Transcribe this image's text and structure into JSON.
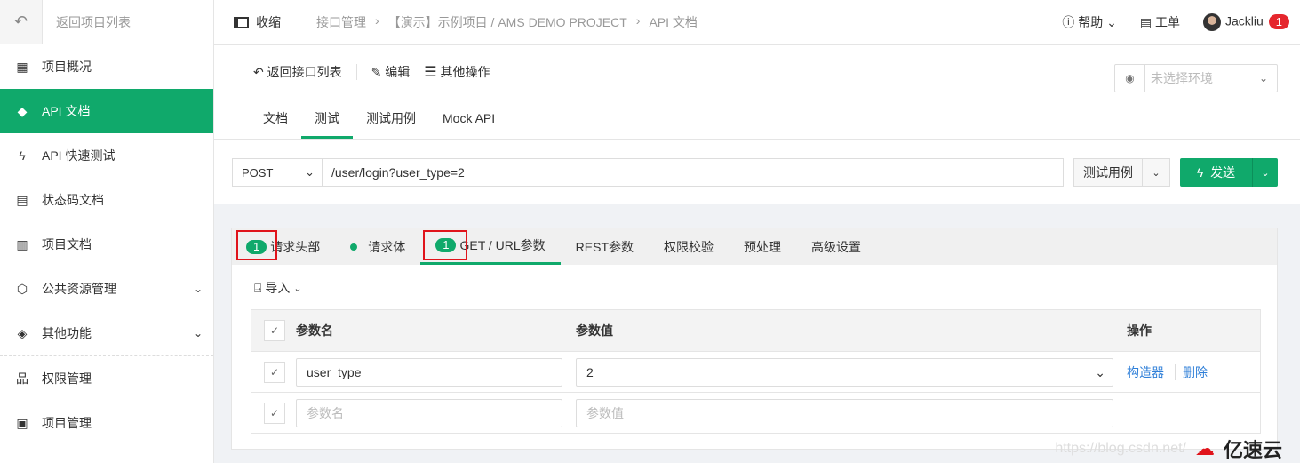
{
  "sidebar": {
    "back_label": "返回项目列表",
    "items": [
      {
        "label": "项目概况",
        "icon": "calculator-icon"
      },
      {
        "label": "API 文档",
        "icon": "tag-icon",
        "active": true
      },
      {
        "label": "API 快速测试",
        "icon": "lightning-icon"
      },
      {
        "label": "状态码文档",
        "icon": "doc-icon"
      },
      {
        "label": "项目文档",
        "icon": "list-icon"
      },
      {
        "label": "公共资源管理",
        "icon": "cube-icon",
        "expandable": true
      },
      {
        "label": "其他功能",
        "icon": "layers-icon",
        "expandable": true
      },
      {
        "label": "权限管理",
        "icon": "org-icon"
      },
      {
        "label": "项目管理",
        "icon": "clipboard-icon"
      }
    ]
  },
  "header": {
    "collapse": "收缩",
    "breadcrumb": [
      "接口管理",
      "【演示】示例项目 / AMS DEMO PROJECT",
      "API 文档"
    ],
    "help": "帮助",
    "ticket": "工单",
    "user": "Jackliu",
    "notif_count": "1"
  },
  "toolbar": {
    "back": "返回接口列表",
    "edit": "编辑",
    "more": "其他操作",
    "env_placeholder": "未选择环境"
  },
  "tabs": [
    "文档",
    "测试",
    "测试用例",
    "Mock API"
  ],
  "request": {
    "method": "POST",
    "url": "/user/login?user_type=2",
    "case_button": "测试用例",
    "send_button": "发送"
  },
  "panel": {
    "tabs": [
      {
        "label": "请求头部",
        "count": "1"
      },
      {
        "label": "请求体",
        "dot": true
      },
      {
        "label": "GET / URL参数",
        "count": "1",
        "active": true
      },
      {
        "label": "REST参数"
      },
      {
        "label": "权限校验"
      },
      {
        "label": "预处理"
      },
      {
        "label": "高级设置"
      }
    ],
    "import": "导入",
    "table": {
      "headers": [
        "参数名",
        "参数值",
        "操作"
      ],
      "rows": [
        {
          "name": "user_type",
          "value": "2",
          "actions": [
            "构造器",
            "删除"
          ]
        }
      ],
      "name_placeholder": "参数名",
      "value_placeholder": "参数值"
    }
  },
  "watermark": {
    "url": "https://blog.csdn.net/",
    "brand": "亿速云"
  },
  "colors": {
    "accent": "#10a96b",
    "badge": "#e5262d",
    "link": "#2f7fd8",
    "highlight": "#e0141b"
  }
}
